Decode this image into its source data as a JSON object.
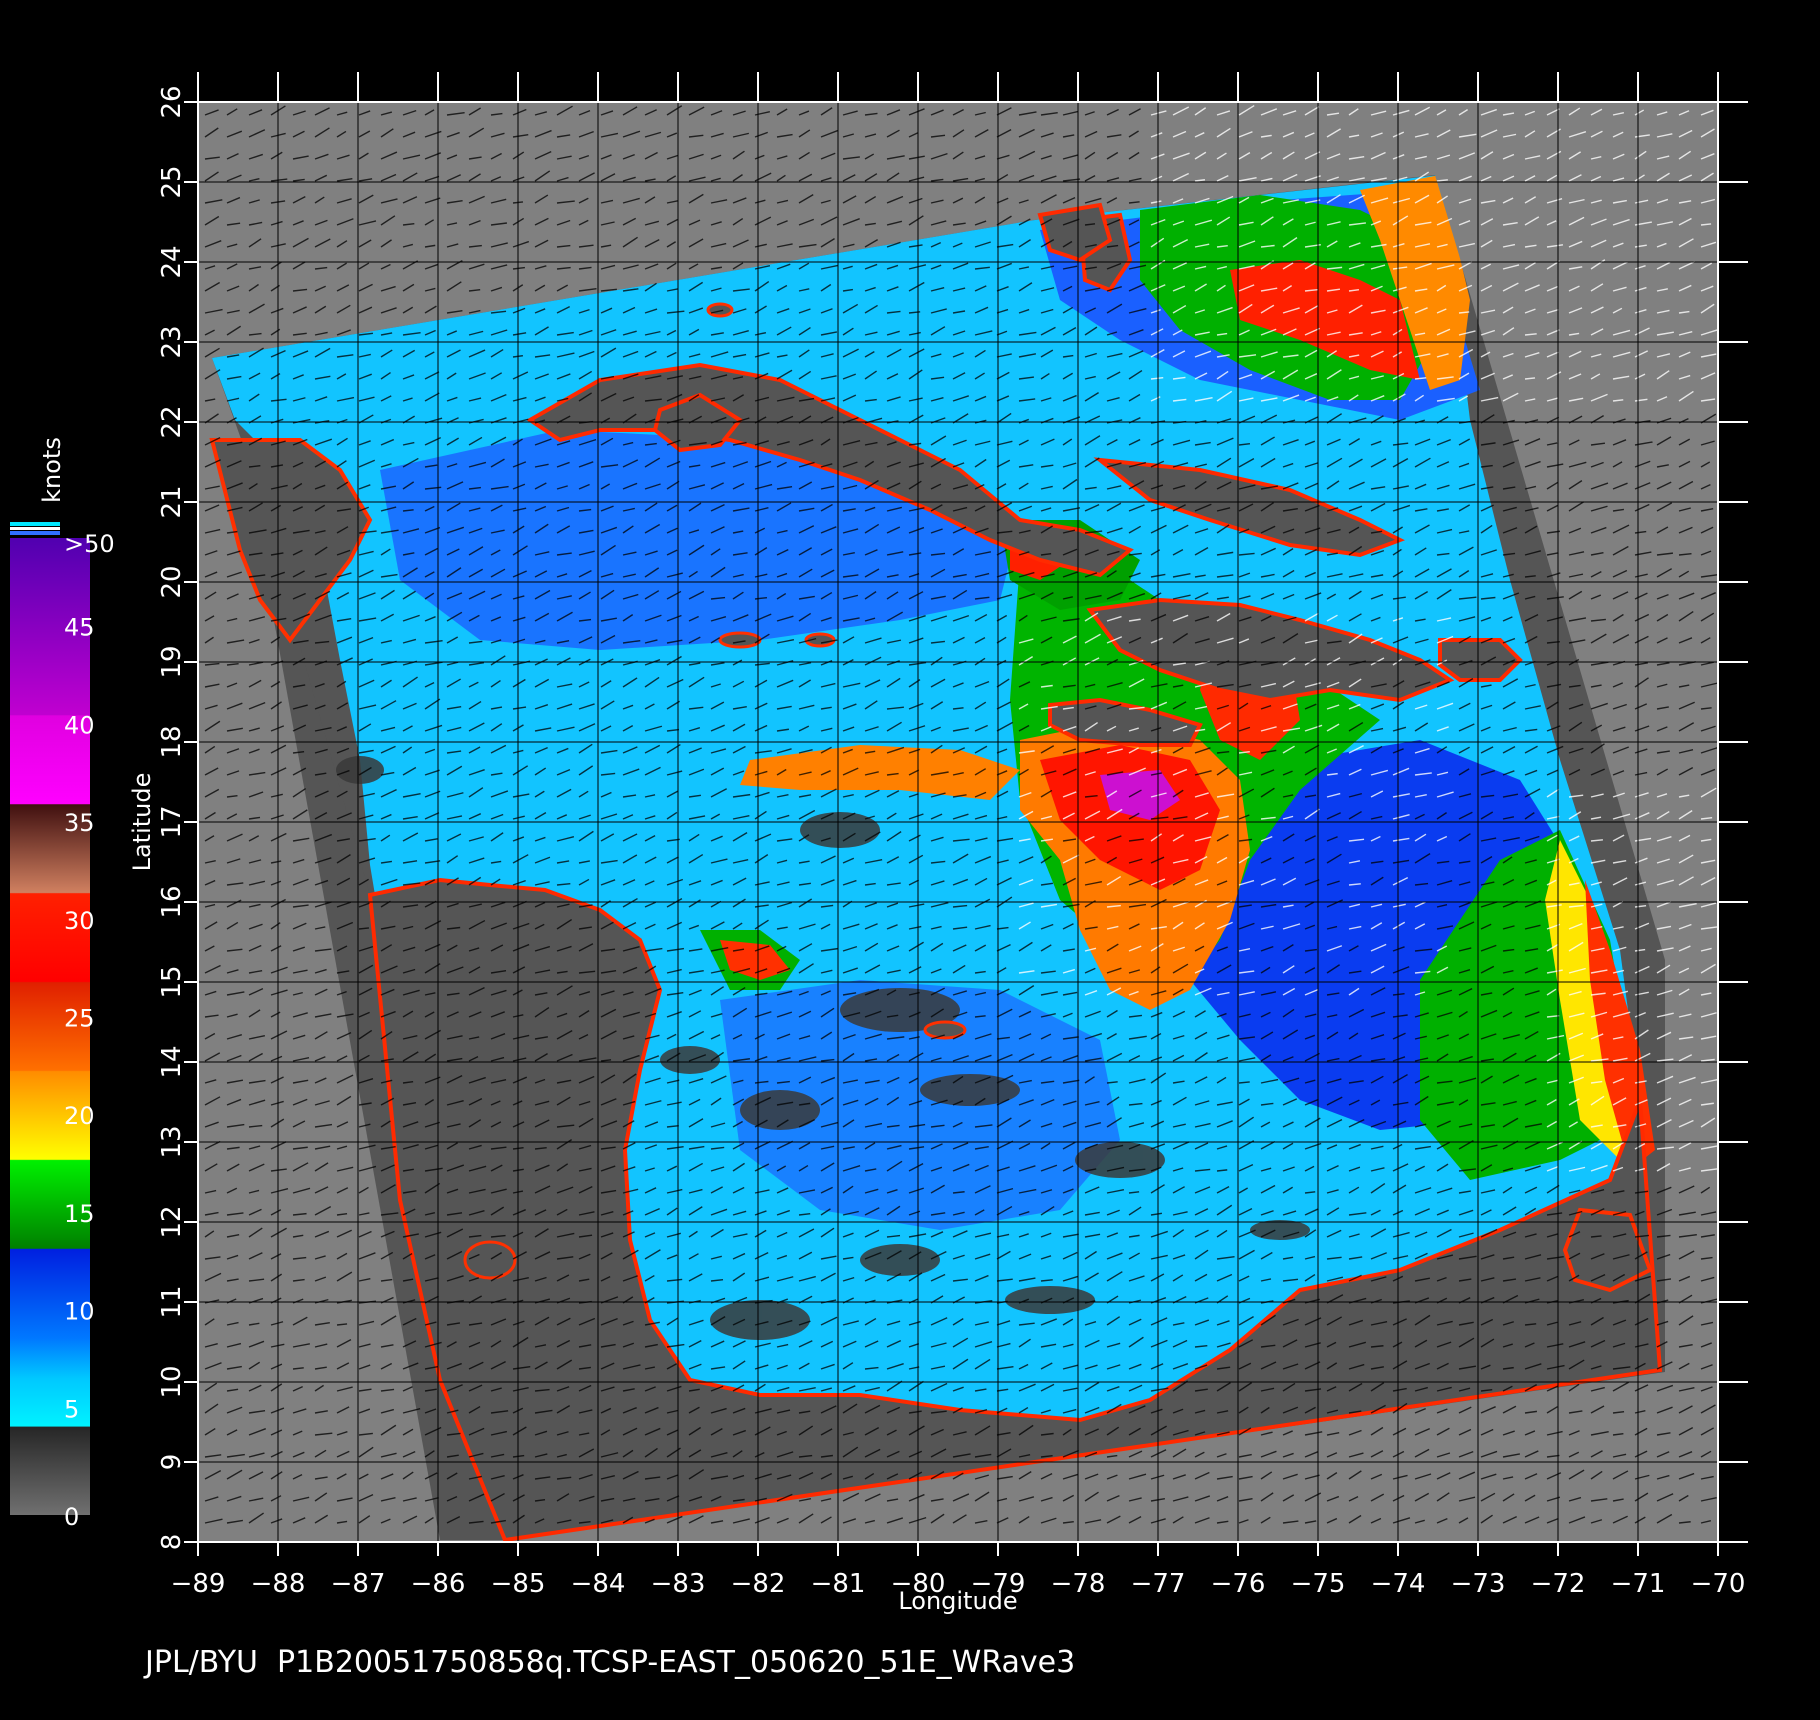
{
  "map": {
    "axes": {
      "x_title": "Longitude",
      "y_title": "Latitude",
      "lon_ticks": [
        "−89",
        "−88",
        "−87",
        "−86",
        "−85",
        "−84",
        "−83",
        "−82",
        "−81",
        "−80",
        "−79",
        "−78",
        "−77",
        "−76",
        "−75",
        "−74",
        "−73",
        "−72",
        "−71",
        "−70"
      ],
      "lat_ticks": [
        "8",
        "9",
        "10",
        "11",
        "12",
        "13",
        "14",
        "15",
        "16",
        "17",
        "18",
        "19",
        "20",
        "21",
        "22",
        "23",
        "24",
        "25",
        "26"
      ],
      "lon_range": [
        -89,
        -70
      ],
      "lat_range": [
        8,
        26
      ],
      "grid": true
    },
    "colorbar": {
      "unit": "knots",
      "labels": [
        "0",
        "5",
        "10",
        "15",
        "20",
        "25",
        "30",
        "35",
        "40",
        "45",
        ">50"
      ],
      "colors": {
        "land_no_data": "#808080",
        "swath_land": "#555555",
        "low_0_5": "#3a3a3a",
        "cyan_5_10": "#00d8ff",
        "blue_10_15": "#0050ff",
        "green_15_20": "#00b000",
        "yellow_20_25": "#ffee00",
        "orange_25_30": "#ff7a00",
        "red_30_35": "#ff1a00",
        "brown_35_40": "#7a3020",
        "magenta_40_45": "#ff00e0",
        "purple_45_50": "#8000d0"
      }
    },
    "footer": "JPL/BYU  P1B20051750858q.TCSP-EAST_050620_51E_WRave3"
  }
}
